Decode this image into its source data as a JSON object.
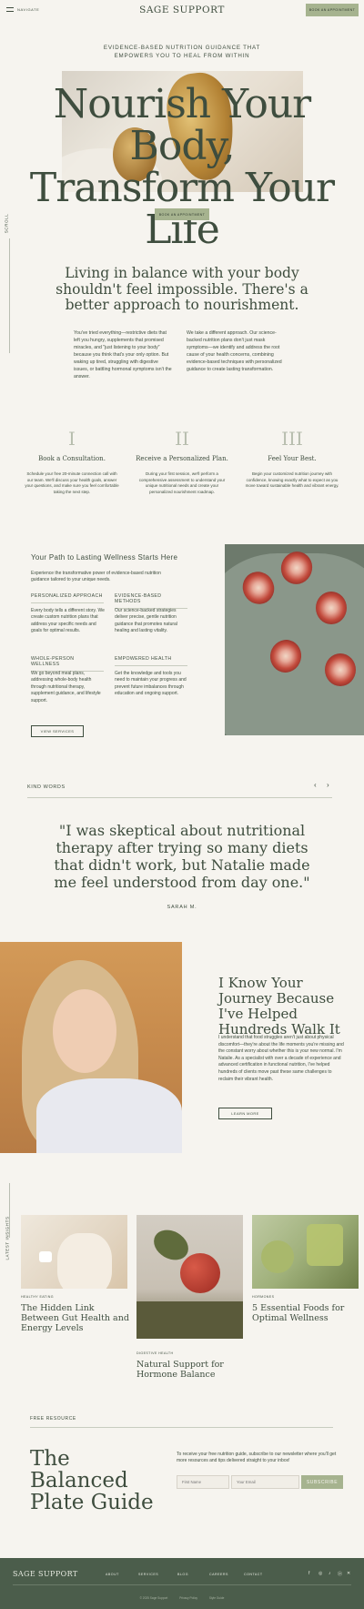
{
  "header": {
    "navigate_label": "NAVIGATE",
    "logo": "SAGE SUPPORT",
    "book_button": "BOOK AN APPOINTMENT"
  },
  "hero": {
    "kicker_line1": "EVIDENCE-BASED NUTRITION GUIDANCE THAT",
    "kicker_line2": "EMPOWERS YOU TO HEAL FROM WITHIN",
    "title_line1": "Nourish Your Body,",
    "title_line2": "Transform Your Life",
    "book_button": "BOOK AN APPOINTMENT",
    "scroll_label": "SCROLL"
  },
  "intro": {
    "headline": "Living in balance with your body shouldn't feel impossible. There's a better approach to nourishment.",
    "col1": "You've tried everything—restrictive diets that left you hungry, supplements that promised miracles, and \"just listening to your body\" because you think that's your only option. But waking up tired, struggling with digestive issues, or battling hormonal symptoms isn't the answer.",
    "col2": "We take a different approach. Our science-backed nutrition plans don't just mask symptoms—we identify and address the root cause of your health concerns, combining evidence-based techniques with personalized guidance to create lasting transformation."
  },
  "steps": [
    {
      "num": "I",
      "title": "Book a Consultation.",
      "desc": "Schedule your free 20-minute connection call with our team. We'll discuss your health goals, answer your questions, and make sure you feel comfortable taking the next step."
    },
    {
      "num": "II",
      "title": "Receive a Personalized Plan.",
      "desc": "During your first session, we'll perform a comprehensive assessment to understand your unique nutritional needs and create your personalized nourishment roadmap."
    },
    {
      "num": "III",
      "title": "Feel Your Best.",
      "desc": "Begin your customized nutrition journey with confidence, knowing exactly what to expect as you move toward sustainable health and vibrant energy."
    }
  ],
  "wellness": {
    "title": "Your Path to Lasting Wellness Starts Here",
    "subtitle": "Experience the transformative power of evidence-based nutrition guidance tailored to your unique needs.",
    "items": [
      {
        "heading": "PERSONALIZED APPROACH",
        "text": "Every body tells a different story. We create custom nutrition plans that address your specific needs and goals for optimal results."
      },
      {
        "heading": "EVIDENCE-BASED METHODS",
        "text": "Our science-backed strategies deliver precise, gentle nutrition guidance that promotes natural healing and lasting vitality."
      },
      {
        "heading": "WHOLE-PERSON WELLNESS",
        "text": "We go beyond meal plans, addressing whole-body health through nutritional therapy, supplement guidance, and lifestyle support."
      },
      {
        "heading": "EMPOWERED HEALTH",
        "text": "Get the knowledge and tools you need to maintain your progress and prevent future imbalances through education and ongoing support."
      }
    ],
    "button": "VIEW SERVICES"
  },
  "testimonial": {
    "label": "KIND WORDS",
    "prev": "‹",
    "next": "›",
    "quote": "\"I was skeptical about nutritional therapy after trying so many diets that didn't work, but Natalie made me feel understood from day one.\"",
    "author": "SARAH M."
  },
  "about": {
    "headline": "I Know Your Journey Because I've Helped Hundreds Walk It",
    "text": "I understand that food struggles aren't just about physical discomfort—they're about the life moments you're missing and the constant worry about whether this is your new normal. I'm Natalie. As a specialist with over a decade of experience and advanced certification in functional nutrition, I've helped hundreds of clients move past these same challenges to reclaim their vibrant health.",
    "button": "LEARN MORE"
  },
  "latest": {
    "label": "LATEST INSIGHTS",
    "posts": [
      {
        "tag": "HEALTHY EATING",
        "title": "The Hidden Link Between Gut Health and Energy Levels"
      },
      {
        "tag": "HORMONES",
        "title": "5 Essential Foods for Optimal Wellness"
      },
      {
        "tag": "DIGESTIVE HEALTH",
        "title": "Natural Support for Hormone Balance"
      }
    ]
  },
  "resource": {
    "label": "FREE RESOURCE",
    "title": "The Balanced Plate Guide",
    "text": "To receive your free nutrition guide, subscribe to our newsletter where you'll get more resources and tips delivered straight to your inbox!",
    "first_name_placeholder": "First Name",
    "email_placeholder": "Your Email",
    "subscribe": "SUBSCRIBE"
  },
  "footer": {
    "logo": "SAGE SUPPORT",
    "links": [
      "ABOUT",
      "SERVICES",
      "BLOG",
      "CAREERS",
      "CONTACT"
    ],
    "copyright": "© 2025 Sage Support",
    "privacy": "Privacy Policy",
    "style_guide": "Style Guide"
  },
  "colors": {
    "background": "#f6f4ef",
    "text": "#3e4d3e",
    "accent": "#a6b38f",
    "footer": "#4b5d4b"
  }
}
